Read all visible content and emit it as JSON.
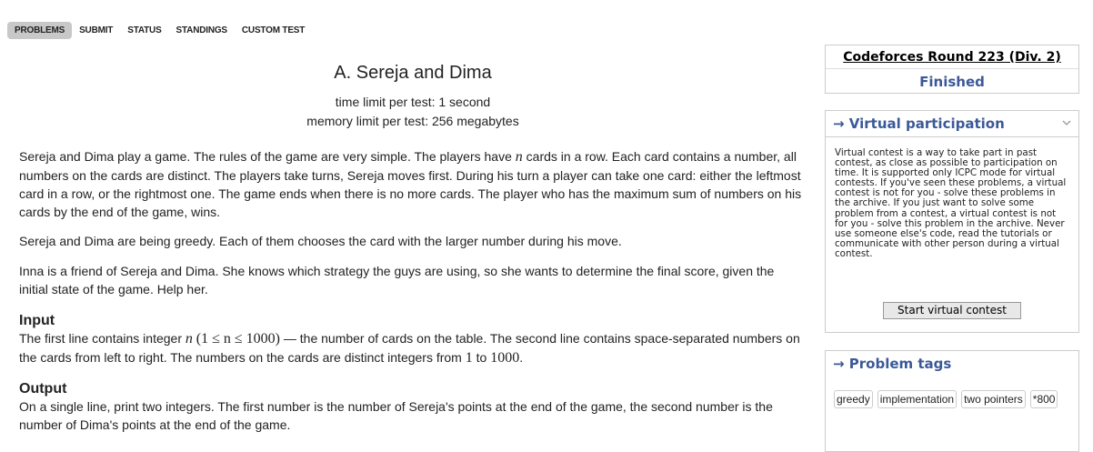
{
  "nav": {
    "items": [
      {
        "label": "PROBLEMS",
        "active": true
      },
      {
        "label": "SUBMIT",
        "active": false
      },
      {
        "label": "STATUS",
        "active": false
      },
      {
        "label": "STANDINGS",
        "active": false
      },
      {
        "label": "CUSTOM TEST",
        "active": false
      }
    ]
  },
  "problem": {
    "title": "A. Sereja and Dima",
    "time_limit": "time limit per test: 1 second",
    "memory_limit": "memory limit per test: 256 megabytes",
    "p1_a": "Sereja and Dima play a game. The rules of the game are very simple. The players have ",
    "p1_var": "n",
    "p1_b": " cards in a row. Each card contains a number, all numbers on the cards are distinct. The players take turns, Sereja moves first. During his turn a player can take one card: either the leftmost card in a row, or the rightmost one. The game ends when there is no more cards. The player who has the maximum sum of numbers on his cards by the end of the game, wins.",
    "p2": "Sereja and Dima are being greedy. Each of them chooses the card with the larger number during his move.",
    "p3": "Inna is a friend of Sereja and Dima. She knows which strategy the guys are using, so she wants to determine the final score, given the initial state of the game. Help her.",
    "input_title": "Input",
    "input_a": "The first line contains integer ",
    "input_var": "n",
    "input_constraint": "(1 ≤ n ≤ 1000)",
    "input_b": " — the number of cards on the table. The second line contains space-separated numbers on the cards from left to right. The numbers on the cards are distinct integers from ",
    "input_min": "1",
    "input_to": " to ",
    "input_max": "1000",
    "input_end": ".",
    "output_title": "Output",
    "output_text": "On a single line, print two integers. The first number is the number of Sereja's points at the end of the game, the second number is the number of Dima's points at the end of the game."
  },
  "sidebar": {
    "contest_name": "Codeforces Round 223 (Div. 2)",
    "contest_status": "Finished",
    "virtual": {
      "title": "→ Virtual participation",
      "text": "Virtual contest is a way to take part in past contest, as close as possible to participation on time. It is supported only ICPC mode for virtual contests. If you've seen these problems, a virtual contest is not for you - solve these problems in the archive. If you just want to solve some problem from a contest, a virtual contest is not for you - solve this problem in the archive. Never use someone else's code, read the tutorials or communicate with other person during a virtual contest.",
      "button": "Start virtual contest"
    },
    "tags": {
      "title": "→ Problem tags",
      "items": [
        "greedy",
        "implementation",
        "two pointers",
        "*800"
      ]
    }
  },
  "colors": {
    "accent": "#3b5998",
    "nav_active_bg": "#c8c8c8"
  }
}
